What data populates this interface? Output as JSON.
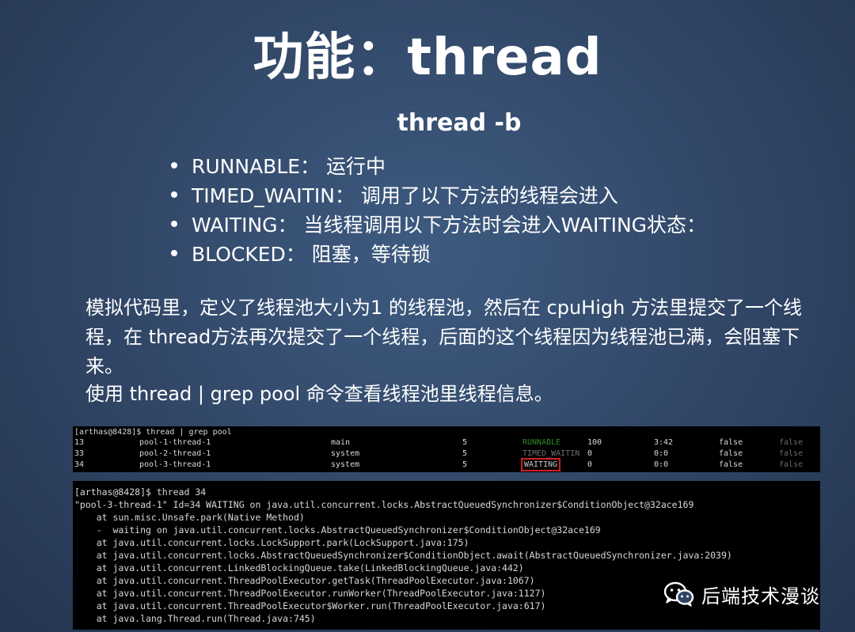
{
  "slide": {
    "title": "功能：thread",
    "subtitle": "thread -b",
    "bullets": [
      "RUNNABLE： 运行中",
      "TIMED_WAITIN： 调用了以下方法的线程会进入",
      "WAITING： 当线程调用以下方法时会进入WAITING状态：",
      "BLOCKED： 阻塞，等待锁"
    ],
    "paragraph1": "模拟代码里，定义了线程池大小为1 的线程池，然后在 cpuHigh 方法里提交了一个线程，在 thread方法再次提交了一个线程，后面的这个线程因为线程池已满，会阻塞下来。",
    "paragraph2": "使用 thread | grep pool 命令查看线程池里线程信息。"
  },
  "terminal1": {
    "command": "[arthas@8428]$ thread | grep pool",
    "rows": [
      {
        "id": "13",
        "name": "pool-1-thread-1",
        "group": "main",
        "priority": "5",
        "state": "RUNNABLE",
        "cpu": "100",
        "time": "3:42",
        "interrupted": "false",
        "daemon": "false"
      },
      {
        "id": "33",
        "name": "pool-2-thread-1",
        "group": "system",
        "priority": "5",
        "state": "TIMED_WAITIN",
        "cpu": "0",
        "time": "0:0",
        "interrupted": "false",
        "daemon": "false"
      },
      {
        "id": "34",
        "name": "pool-3-thread-1",
        "group": "system",
        "priority": "5",
        "state": "WAITING",
        "cpu": "0",
        "time": "0:0",
        "interrupted": "false",
        "daemon": "false"
      }
    ]
  },
  "terminal2": {
    "lines": [
      "[arthas@8428]$ thread 34",
      "\"pool-3-thread-1\" Id=34 WAITING on java.util.concurrent.locks.AbstractQueuedSynchronizer$ConditionObject@32ace169",
      "    at sun.misc.Unsafe.park(Native Method)",
      "    -  waiting on java.util.concurrent.locks.AbstractQueuedSynchronizer$ConditionObject@32ace169",
      "    at java.util.concurrent.locks.LockSupport.park(LockSupport.java:175)",
      "    at java.util.concurrent.locks.AbstractQueuedSynchronizer$ConditionObject.await(AbstractQueuedSynchronizer.java:2039)",
      "    at java.util.concurrent.LinkedBlockingQueue.take(LinkedBlockingQueue.java:442)",
      "    at java.util.concurrent.ThreadPoolExecutor.getTask(ThreadPoolExecutor.java:1067)",
      "    at java.util.concurrent.ThreadPoolExecutor.runWorker(ThreadPoolExecutor.java:1127)",
      "    at java.util.concurrent.ThreadPoolExecutor$Worker.run(ThreadPoolExecutor.java:617)",
      "    at java.lang.Thread.run(Thread.java:745)"
    ]
  },
  "watermark": {
    "icon": "wechat-icon",
    "text": "后端技术漫谈"
  },
  "colors": {
    "background": "#33496a",
    "runnable": "#2e8b2e",
    "waiting_box": "#d02020"
  }
}
